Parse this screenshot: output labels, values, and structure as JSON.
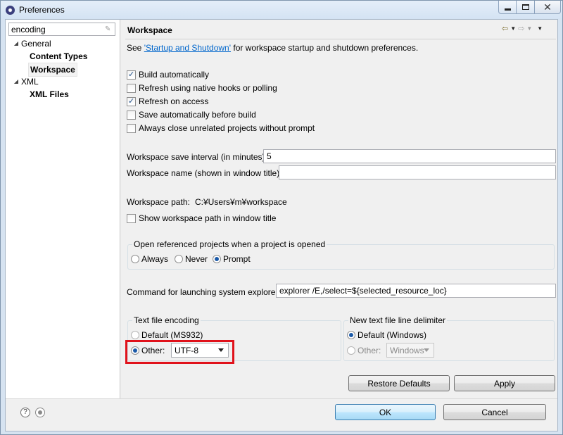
{
  "window": {
    "title": "Preferences",
    "icon": "eclipse-icon"
  },
  "tree": {
    "filter_value": "encoding",
    "items": [
      {
        "label": "General",
        "expanded": true,
        "level": 0
      },
      {
        "label": "Content Types",
        "level": 1
      },
      {
        "label": "Workspace",
        "level": 1,
        "selected": true
      },
      {
        "label": "XML",
        "expanded": true,
        "level": 0
      },
      {
        "label": "XML Files",
        "level": 1
      }
    ]
  },
  "page": {
    "title": "Workspace",
    "see_prefix": "See ",
    "see_link": "'Startup and Shutdown'",
    "see_suffix": " for workspace startup and shutdown preferences.",
    "checkboxes": [
      {
        "label": "Build automatically",
        "checked": true
      },
      {
        "label": "Refresh using native hooks or polling",
        "checked": false
      },
      {
        "label": "Refresh on access",
        "checked": true
      },
      {
        "label": "Save automatically before build",
        "checked": false
      },
      {
        "label": "Always close unrelated projects without prompt",
        "checked": false
      }
    ],
    "save_interval_label": "Workspace save interval (in minutes):",
    "save_interval_value": "5",
    "workspace_name_label": "Workspace name (shown in window title):",
    "workspace_name_value": "",
    "workspace_path_label": "Workspace path:",
    "workspace_path_value": "C:¥Users¥m¥workspace",
    "show_path_label": "Show workspace path in window title",
    "show_path_checked": false,
    "open_ref_group": {
      "title": "Open referenced projects when a project is opened",
      "options": [
        "Always",
        "Never",
        "Prompt"
      ],
      "selected": "Prompt"
    },
    "explorer_label": "Command for launching system explorer:",
    "explorer_value": "explorer /E,/select=${selected_resource_loc}",
    "encoding_group": {
      "title": "Text file encoding",
      "default_label": "Default (MS932)",
      "other_label": "Other:",
      "other_value": "UTF-8",
      "selected": "other"
    },
    "delimiter_group": {
      "title": "New text file line delimiter",
      "default_label": "Default (Windows)",
      "other_label": "Other:",
      "other_value": "Windows",
      "selected": "default"
    },
    "restore_defaults_label": "Restore Defaults",
    "apply_label": "Apply"
  },
  "footer": {
    "ok_label": "OK",
    "cancel_label": "Cancel"
  },
  "colors": {
    "accent": "#1b5aa8",
    "highlight": "#e0121b",
    "link": "#0066cc"
  }
}
